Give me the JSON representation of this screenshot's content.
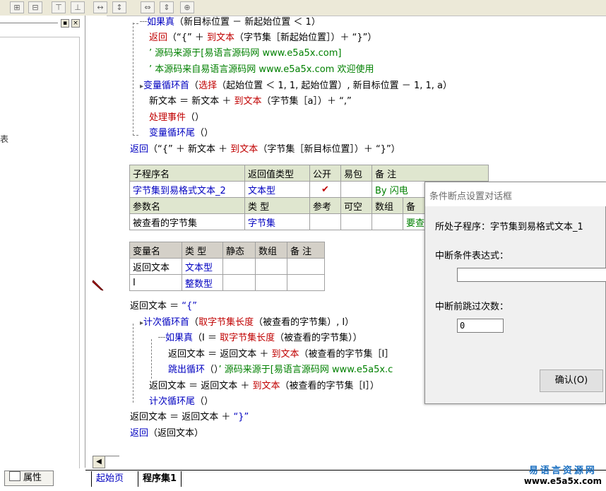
{
  "toolbar": {
    "icons": [
      "align-left-icon",
      "align-center-icon",
      "align-right-icon",
      "align-justify-icon",
      "same-width-icon",
      "same-height-icon",
      "h-space-icon",
      "v-space-icon",
      "center-icon"
    ]
  },
  "left_panel": {
    "close_glyph": "×",
    "pin_glyph": "▪",
    "cut_text": "表"
  },
  "code": {
    "l1": {
      "kw": "如果真",
      "rest": "（新目标位置 － 新起始位置 ＜ 1）"
    },
    "l2": {
      "kw": "返回",
      "a": "（“{” ＋ ",
      "fn": "到文本",
      "b": "（字节集［新起始位置］）＋ “}”）"
    },
    "l3": "’ 源码来源于[易语言源码网 www.e5a5x.com]",
    "l4": "’ 本源码来自易语言源码网 www.e5a5x.com  欢迎使用",
    "l5": {
      "kw": "变量循环首",
      "a": "（",
      "fn": "选择",
      "b": "（起始位置 ＜ 1, 1, 起始位置）, 新目标位置 － 1, 1, a）"
    },
    "l6": {
      "a": "新文本 ＝ 新文本 ＋ ",
      "fn": "到文本",
      "b": "（字节集［a］）＋ “,”"
    },
    "l7": {
      "fn": "处理事件",
      "b": "（）"
    },
    "l8": {
      "kw": "变量循环尾",
      "b": "（）"
    },
    "l9": {
      "kw": "返回",
      "a": "（“{” ＋ 新文本 ＋ ",
      "fn": "到文本",
      "b": "（字节集［新目标位置］）＋ “}”）"
    },
    "l10": {
      "a": "返回文本 ＝ ",
      "str": "“{”"
    },
    "l11": {
      "kw": "计次循环首",
      "a": "（",
      "fn": "取字节集长度",
      "b": "（被查看的字节集）, I）"
    },
    "l12": {
      "kw": "如果真",
      "a": "（I ＝ ",
      "fn": "取字节集长度",
      "b": "（被查看的字节集））"
    },
    "l13": {
      "a": "返回文本 ＝ 返回文本 ＋ ",
      "fn": "到文本",
      "b": "（被查看的字节集［I］"
    },
    "l14": {
      "kw": "跳出循环",
      "a": "（）",
      "cmt": "’ 源码来源于[易语言源码网 www.e5a5x.c"
    },
    "l15": {
      "a": "返回文本 ＝ 返回文本 ＋ ",
      "fn": "到文本",
      "b": "（被查看的字节集［I］）"
    },
    "l16": {
      "kw": "计次循环尾",
      "b": "（）"
    },
    "l17": {
      "a": "返回文本 ＝ 返回文本 ＋ ",
      "str": "“}”"
    },
    "l18": {
      "kw": "返回",
      "b": "（返回文本）"
    }
  },
  "sub_table": {
    "headers": [
      "子程序名",
      "返回值类型",
      "公开",
      "易包",
      "备 注"
    ],
    "row": {
      "name": "字节集到易格式文本_2",
      "type": "文本型",
      "public": "✔",
      "pkg": "",
      "note": "By 闪电"
    },
    "param_headers": [
      "参数名",
      "类 型",
      "参考",
      "可空",
      "数组",
      "备"
    ],
    "param_row": {
      "name": "被查看的字节集",
      "type": "字节集",
      "ref": "",
      "nullable": "",
      "array": "",
      "note": "要查"
    }
  },
  "var_table": {
    "headers": [
      "变量名",
      "类 型",
      "静态",
      "数组",
      "备 注"
    ],
    "rows": [
      {
        "name": "返回文本",
        "type": "文本型"
      },
      {
        "name": "I",
        "type": "整数型"
      }
    ]
  },
  "dialog": {
    "title": "条件断点设置对话框",
    "location_label": "所处子程序：字节集到易格式文本_1",
    "condition_label": "中断条件表达式：",
    "condition_value": "",
    "skip_label": "中断前跳过次数：",
    "skip_value": "0",
    "ok_label": "确认(O)"
  },
  "bottom": {
    "props_label": "属性",
    "tab_home": "起始页",
    "tab_progset": "程序集1",
    "scroll_left": "◀"
  },
  "brand": {
    "name": "易语言资源网",
    "url": "www.e5a5x.com"
  },
  "colors": {
    "keyword": "#0000c0",
    "function": "#c00000",
    "comment": "#008000"
  }
}
